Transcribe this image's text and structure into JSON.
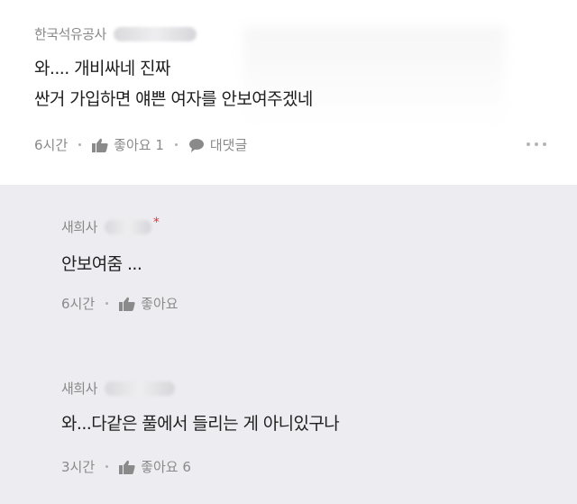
{
  "top_comment": {
    "author": "한국석유공사",
    "text_line1": "와.... 개비싸네 진짜",
    "text_line2": "싼거 가입하면 얘쁜 여자를 안보여주겠네",
    "time": "6시간",
    "like_label": "좋아요 1",
    "reply_label": "대댓글",
    "more_icon": "more-dots-icon",
    "like_icon": "thumbs-up-icon",
    "reply_icon": "speech-bubble-icon"
  },
  "replies": [
    {
      "author": "새희사",
      "text": "안보여줌 ...",
      "time": "6시간",
      "like_label": "좋아요"
    },
    {
      "author": "새희사",
      "text": "와...다같은 풀에서 들리는 게 아니있구나",
      "time": "3시간",
      "like_label": "좋아요 6"
    }
  ],
  "colors": {
    "top_bg": "#ffffff",
    "reply_bg": "#ededf1",
    "red_marker": "#e0323a",
    "meta_text": "#8a8a8a"
  }
}
